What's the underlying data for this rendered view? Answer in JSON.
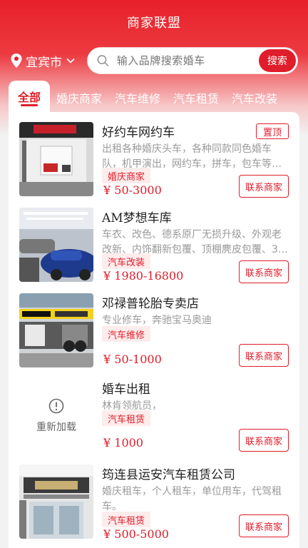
{
  "header": {
    "title": "商家联盟"
  },
  "location": {
    "city": "宜宾市"
  },
  "search": {
    "placeholder": "输入品牌搜索婚车",
    "button_label": "搜索"
  },
  "tabs": [
    {
      "label": "全部",
      "active": true
    },
    {
      "label": "婚庆商家"
    },
    {
      "label": "汽车维修"
    },
    {
      "label": "汽车租赁"
    },
    {
      "label": "汽车改装"
    }
  ],
  "contact_label": "联系商家",
  "reload_label": "重新加载",
  "pin_label": "置顶",
  "accent_color": "#e01d2a",
  "merchants": [
    {
      "name": "好约车网约车",
      "desc": "出租各种婚庆头车，各种同款同色婚车队，机甲演出，网约车，拼车，包车等…",
      "tag": "婚庆商家",
      "price": "¥ 50-3000",
      "pinned": true
    },
    {
      "name": "AM梦想车库",
      "desc": "车衣、改色、德系原厂无损升级、外观老改新、内饰翻新包覆、顶棚麂皮包覆、3…",
      "tag": "汽车改装",
      "price": "¥ 1980-16800"
    },
    {
      "name": "邓禄普轮胎专卖店",
      "desc": "专业修车，奔驰宝马奥迪",
      "tag": "汽车维修",
      "price": "¥ 50-1000"
    },
    {
      "name": "婚车出租",
      "desc": "林肯领航员，",
      "tag": "汽车租赁",
      "price": "¥ 1000"
    },
    {
      "name": "筠连县运安汽车租赁公司",
      "desc": "婚庆租车，个人租车，单位用车，代驾租车。",
      "tag": "汽车租赁",
      "price": "¥ 500-5000"
    }
  ]
}
